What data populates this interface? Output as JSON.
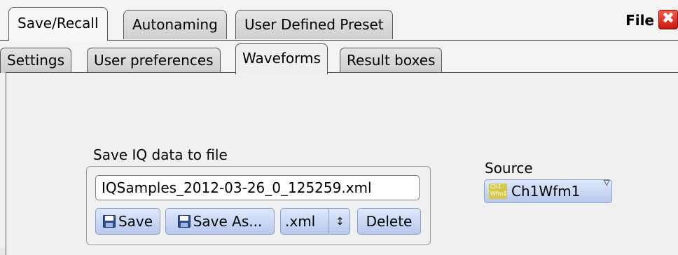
{
  "title": "File",
  "top_tabs": [
    {
      "label": "Save/Recall",
      "active": true
    },
    {
      "label": "Autonaming",
      "active": false
    },
    {
      "label": "User Defined Preset",
      "active": false
    }
  ],
  "sub_tabs": [
    {
      "label": "Settings",
      "active": false
    },
    {
      "label": "User preferences",
      "active": false
    },
    {
      "label": "Waveforms",
      "active": true
    },
    {
      "label": "Result boxes",
      "active": false
    }
  ],
  "iq_group": {
    "label": "Save IQ data to file",
    "filename": "IQSamples_2012-03-26_0_125259.xml",
    "save_label": "Save",
    "save_as_label": "Save As...",
    "format_value": ".xml",
    "format_arrow": "↕",
    "delete_label": "Delete"
  },
  "source": {
    "label": "Source",
    "value": "Ch1Wfm1",
    "icon_text_top": "Ch1",
    "icon_text_bottom": "Wfm1",
    "dropdown_glyph": "▽"
  },
  "close_glyph": "✖",
  "colors": {
    "close_red": "#e0261a",
    "button_blue": "#c6d5f4",
    "source_icon": "#d8c84a"
  }
}
